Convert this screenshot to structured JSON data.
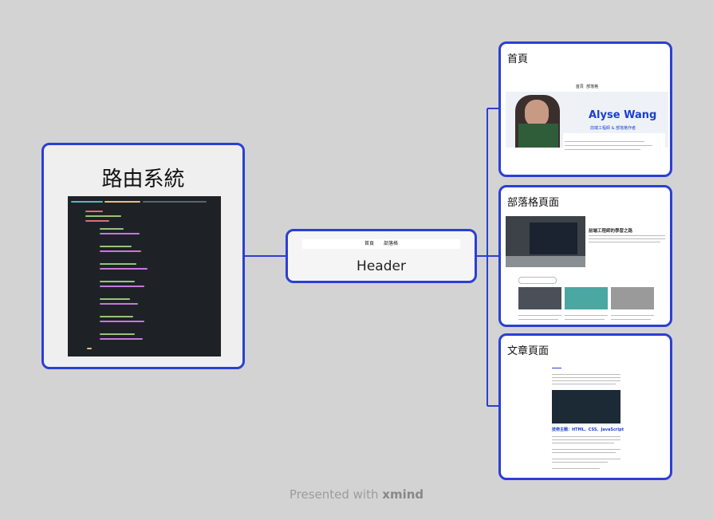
{
  "root": {
    "title": "路由系統",
    "code_image": "react-router-code-screenshot"
  },
  "middle": {
    "title": "Header",
    "nav": [
      "首頁",
      "部落格"
    ]
  },
  "leaves": [
    {
      "title": "首頁",
      "thumbnail": {
        "nav": [
          "首頁",
          "部落格"
        ],
        "name": "Alyse Wang",
        "subtitle": "前端工程師 & 部落格作者"
      }
    },
    {
      "title": "部落格頁面",
      "thumbnail": {
        "featured_title": "前端工程師的學習之路"
      }
    },
    {
      "title": "文章頁面",
      "thumbnail": {
        "section_heading": "技術主題：HTML、CSS、JavaScript"
      }
    }
  ],
  "footer": {
    "prefix": "Presented with",
    "brand": "xmind"
  },
  "colors": {
    "border": "#2b3fd4",
    "connector": "#2b3fd4",
    "background": "#d3d3d3"
  }
}
